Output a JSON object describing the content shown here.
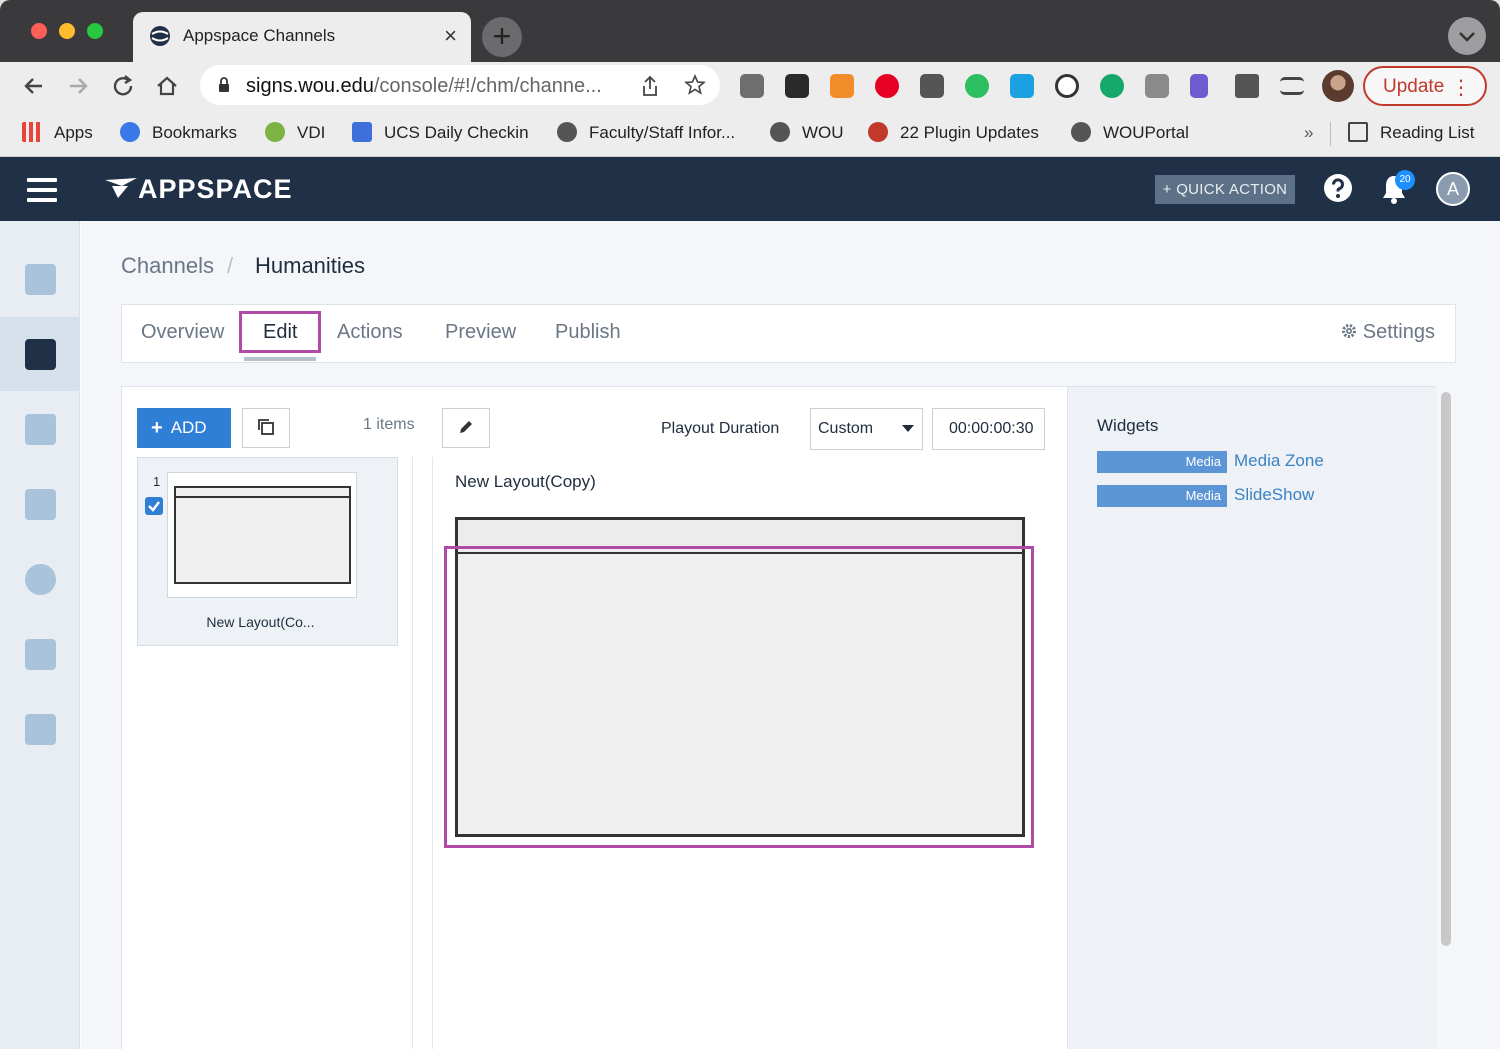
{
  "browser": {
    "tab_title": "Appspace Channels",
    "tab_close": "×",
    "new_tab": "+",
    "url_host": "signs.wou.edu",
    "url_path": "/console/#!/chm/channe...",
    "update_label": "Update",
    "update_more": "⋮",
    "bookmarks": [
      {
        "label": "Apps",
        "icon": "apps-grid-icon",
        "color": "#e8453c"
      },
      {
        "label": "Bookmarks",
        "icon": "star-icon",
        "color": "#3b78e7"
      },
      {
        "label": "VDI",
        "icon": "cloud-icon",
        "color": "#7cb342"
      },
      {
        "label": "UCS Daily Checkin",
        "icon": "form-icon",
        "color": "#3f6fd8"
      },
      {
        "label": "Faculty/Staff Infor...",
        "icon": "globe-icon",
        "color": "#555555"
      },
      {
        "label": "WOU",
        "icon": "globe-icon",
        "color": "#555555"
      },
      {
        "label": "22 Plugin Updates",
        "icon": "shield-icon",
        "color": "#c0392b"
      },
      {
        "label": "WOUPortal",
        "icon": "globe-icon",
        "color": "#555555"
      }
    ],
    "bookmarks_overflow": "»",
    "reading_list": "Reading List"
  },
  "app": {
    "logo_text": "APPSPACE",
    "quick_action": "+ QUICK ACTION",
    "notification_count": "20",
    "user_initial": "A"
  },
  "breadcrumb": {
    "root": "Channels",
    "separator": "/",
    "current": "Humanities"
  },
  "tabs": {
    "overview": "Overview",
    "edit": "Edit",
    "actions": "Actions",
    "preview": "Preview",
    "publish": "Publish",
    "settings": "Settings"
  },
  "editor": {
    "add_label": "ADD",
    "items_count": "1 items",
    "playout_label": "Playout Duration",
    "playout_mode": "Custom",
    "playout_time": "00:00:00:30",
    "playlist_item": {
      "number": "1",
      "label": "New Layout(Co..."
    },
    "layout_title": "New Layout(Copy)"
  },
  "widgets": {
    "title": "Widgets",
    "items": [
      {
        "tag": "Media",
        "name": "Media Zone"
      },
      {
        "tag": "Media",
        "name": "SlideShow"
      }
    ]
  }
}
